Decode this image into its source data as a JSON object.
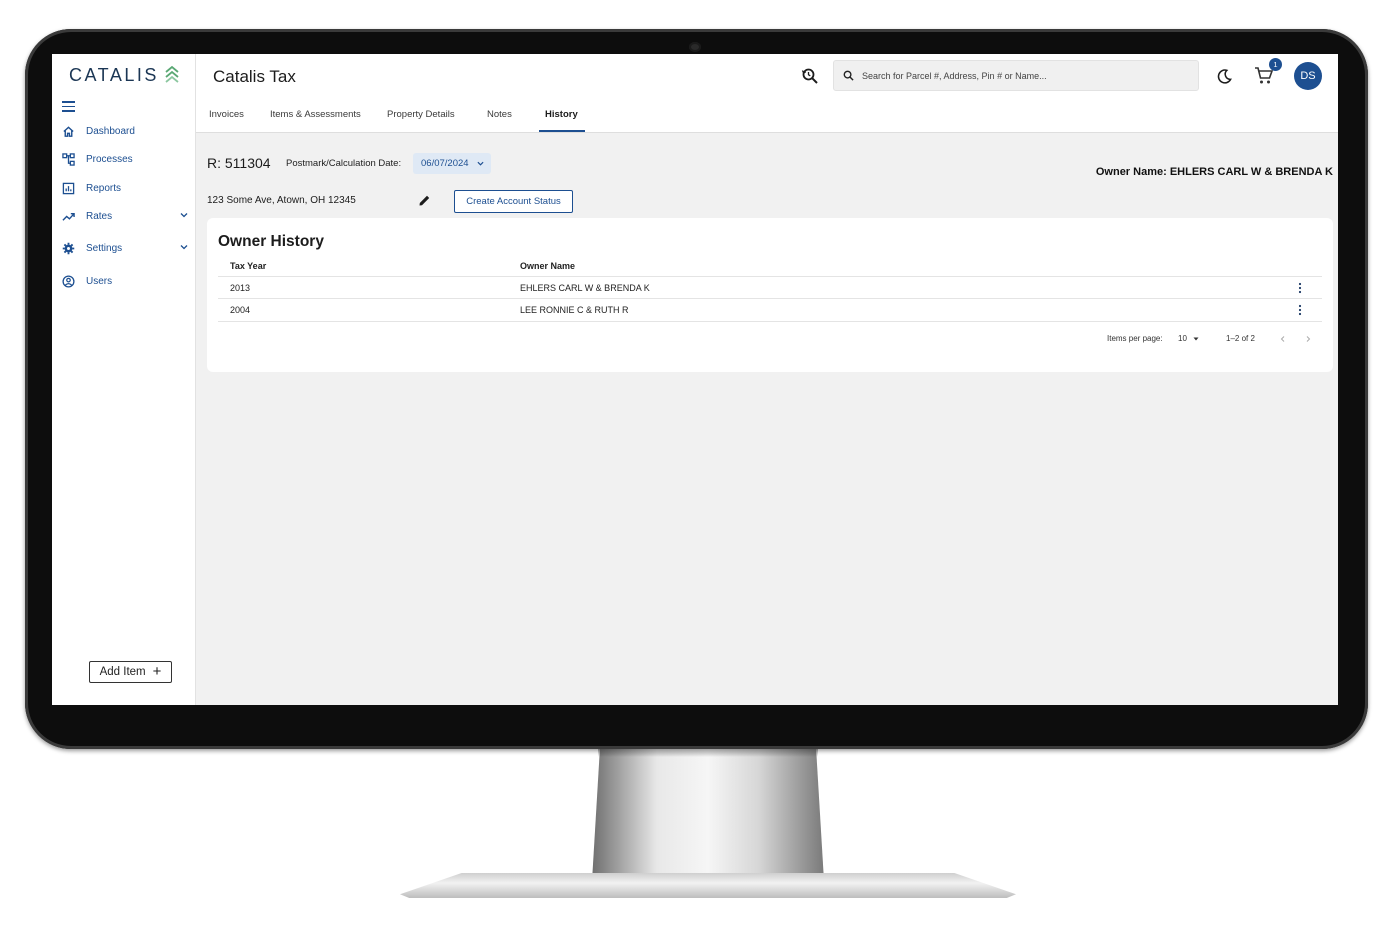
{
  "sidebar": {
    "logo_text": "CATALIS",
    "items": [
      {
        "label": "Dashboard",
        "icon": "home-icon"
      },
      {
        "label": "Processes",
        "icon": "processes-icon"
      },
      {
        "label": "Reports",
        "icon": "reports-icon"
      },
      {
        "label": "Rates",
        "icon": "trending-icon",
        "expandable": true
      },
      {
        "label": "Settings",
        "icon": "gear-icon",
        "expandable": true
      },
      {
        "label": "Users",
        "icon": "user-icon"
      }
    ],
    "add_item_label": "Add Item",
    "add_item_icon": "+"
  },
  "header": {
    "title": "Catalis Tax",
    "search_placeholder": "Search for Parcel #, Address, Pin # or Name...",
    "cart_count": "1",
    "avatar_initials": "DS",
    "tabs": [
      {
        "label": "Invoices",
        "active": false
      },
      {
        "label": "Items & Assessments",
        "active": false
      },
      {
        "label": "Property Details",
        "active": false
      },
      {
        "label": "Notes",
        "active": false
      },
      {
        "label": "History",
        "active": true
      }
    ]
  },
  "account": {
    "id": "R: 511304",
    "postmark_label": "Postmark/Calculation Date:",
    "postmark_date": "06/07/2024",
    "owner_name": "Owner Name: EHLERS CARL W & BRENDA K",
    "address": "123 Some Ave, Atown, OH 12345",
    "create_status_label": "Create Account Status"
  },
  "owner_history": {
    "title": "Owner History",
    "columns": [
      "Tax Year",
      "Owner Name"
    ],
    "rows": [
      {
        "tax_year": "2013",
        "owner_name": "EHLERS CARL W & BRENDA K"
      },
      {
        "tax_year": "2004",
        "owner_name": "LEE RONNIE C & RUTH R"
      }
    ],
    "items_per_page_label": "Items per page:",
    "items_per_page": "10",
    "range": "1–2 of 2"
  },
  "colors": {
    "brand_blue": "#1d4f91",
    "logo_navy": "#1b3654",
    "logo_green": "#5aa874",
    "screen_bg": "#f1f1f1"
  }
}
